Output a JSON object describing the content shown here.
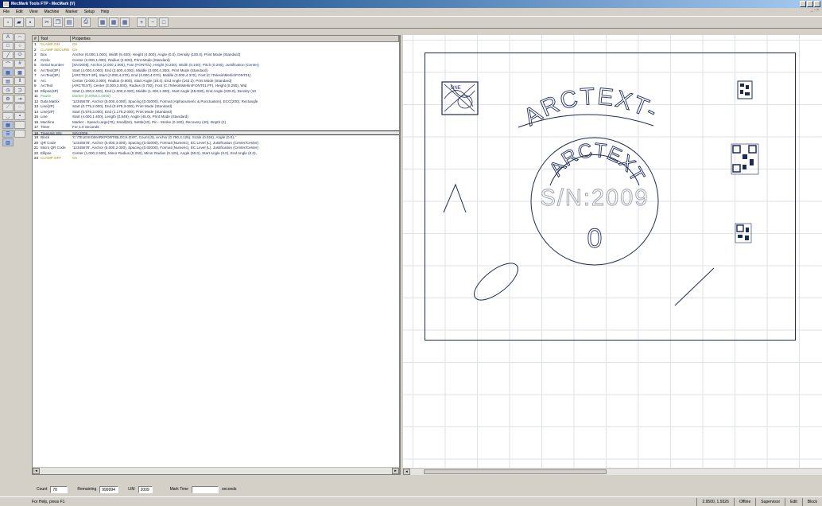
{
  "window": {
    "title": "MecMark Tools FTP - MecMark (V)"
  },
  "menu": [
    "File",
    "Edit",
    "View",
    "Machine",
    "Marker",
    "Setup",
    "Help"
  ],
  "list": {
    "headers": {
      "num": "#",
      "tool": "Tool",
      "prop": "Properties"
    },
    "rows": [
      {
        "num": "1",
        "tool": "CLAMP ON",
        "prop": "On",
        "kind": "ctrl"
      },
      {
        "num": "2",
        "tool": "CLAMP SECURE",
        "prop": "On",
        "kind": "ctrl"
      },
      {
        "num": "3",
        "tool": "Box",
        "prop": "Anchor (0.000,1.000), Width (5.400), Height (4.000), Angle (0.0), Density (100.0), Print Mode (Standard)",
        "kind": "mark"
      },
      {
        "num": "4",
        "tool": "Circle",
        "prop": "Center (2.000,1.000), Radius (1.000), Print Mode (Standard)",
        "kind": "mark"
      },
      {
        "num": "5",
        "tool": "Serial Number",
        "prop": "[SN:0009], Anchor (2.000,1.000), Font (FONT01), Height (0.200), Width (0.100), Pitch (0.200), Justification (Center)",
        "kind": "data"
      },
      {
        "num": "6",
        "tool": "ArcText(3P)",
        "prop": "Start (4.000,4.000), End (2.600,4.000), Middle (3.000,4.300), Print Mode (Standard)",
        "kind": "mark"
      },
      {
        "num": "7",
        "tool": "ArcText(3P)",
        "prop": "[ARCTEXT-3P], Start (2.000,4.070), End (4.000,4.070), Middle (3.000,4.370), Font (C:\\Telesis\\Merlin\\FONT01)",
        "kind": "mark"
      },
      {
        "num": "8",
        "tool": "Arc",
        "prop": "Center (3.000,3.000), Radius (0.800), Start Angle (16.4), End Angle (163.2), Print Mode (Standard)",
        "kind": "mark"
      },
      {
        "num": "9",
        "tool": "ArcText",
        "prop": "[ARCTEXT], Center (3.000,3.000), Radius (0.700), Font (C:\\Telesis\\Merlin\\FONT01.FF), Height (0.250), Wid",
        "kind": "mark"
      },
      {
        "num": "10",
        "tool": "Ellipse(3P)",
        "prop": "Start (1.200,2.400), End (1.000,2.000), Middle (1.400,1.300), Start Angle (45.000), End Angle (225.0), Density (10",
        "kind": "mark"
      },
      {
        "num": "11",
        "tool": "Pause",
        "prop": "Marker (0.0000,1.0000)",
        "kind": "green"
      },
      {
        "num": "12",
        "tool": "Data Matrix",
        "prop": "'12345678', Anchor (5.000,4.000), Spacing (0.02000), Format (Alphanumeric & Punctuation), ECC(200), Rectangle",
        "kind": "mark"
      },
      {
        "num": "13",
        "tool": "Line(2P)",
        "prop": "Start (0.775,2.000), End (0.975,3.000), Print Mode (Standard)",
        "kind": "mark"
      },
      {
        "num": "14",
        "tool": "Line(2P)",
        "prop": "Start (0.975,3.000), End (1.175,2.000), Print Mode (Standard)",
        "kind": "mark"
      },
      {
        "num": "15",
        "tool": "Line",
        "prop": "Start (4.000,1.400), Length (0.849), Angle (45.0), Print Mode (Standard)",
        "kind": "mark"
      },
      {
        "num": "16",
        "tool": "Machine",
        "prop": "Marker - Speed Large(70), Small(62), Settle(10), Pin - Stroke (0.100), Recovery (40), Depth (2)",
        "kind": "mark"
      },
      {
        "num": "17",
        "tool": "Timer",
        "prop": "For 1.0 Seconds",
        "kind": "mark"
      },
      {
        "num": "18",
        "tool": "Transmit S/N",
        "prop": "S/N:2009",
        "kind": "mark",
        "selected": true
      },
      {
        "num": "19",
        "tool": "Block",
        "prop": "'C:\\TELESIS\\MARKPORT\\BLOCK.DXF', Count (0), Anchor (0.750,4.125), Scale (0.024), Angle (0.0), '",
        "kind": "mark"
      },
      {
        "num": "20",
        "tool": "QR Code",
        "prop": "'12345678', Anchor (5.000,3.000), Spacing (0.02000), Format (Numeric), EC Level (L), Justification (Center/Center)",
        "kind": "mark"
      },
      {
        "num": "21",
        "tool": "Micro QR Code",
        "prop": "'12345678', Anchor (5.000,2.000), Spacing (0.02000), Format (Numeric), EC Level (L), Justification (Center/Center)",
        "kind": "mark"
      },
      {
        "num": "22",
        "tool": "Ellipse",
        "prop": "Center (1.000,2.500), Minor Radius (0.250), Minor Radius (0.125), Angle (90.0), Start Angle (0.0), End Angle (0.0),",
        "kind": "mark"
      },
      {
        "num": "23",
        "tool": "CLAMP OFF",
        "prop": "On",
        "kind": "ctrl"
      }
    ]
  },
  "canvas": {
    "arctext_3p": "ARCTEXT-3P",
    "arctext": "ARCTEXT",
    "serial": "S/N:2009",
    "zero": "0",
    "block_label": "DNE"
  },
  "status_fields": {
    "count_label": "Count",
    "count_value": "70",
    "remaining_label": "Remaining",
    "remaining_value": "999994",
    "lim_label": "LIM",
    "lim_value": "2009",
    "mark_time_label": "Mark Time",
    "mark_time_value": "",
    "seconds_label": "seconds"
  },
  "statusbar": {
    "message": "For Help, press F1",
    "coords": "2.9500, 1.9326",
    "connection": "Offline",
    "user": "Supervisor",
    "edit": "Edit",
    "mode": "Block"
  }
}
